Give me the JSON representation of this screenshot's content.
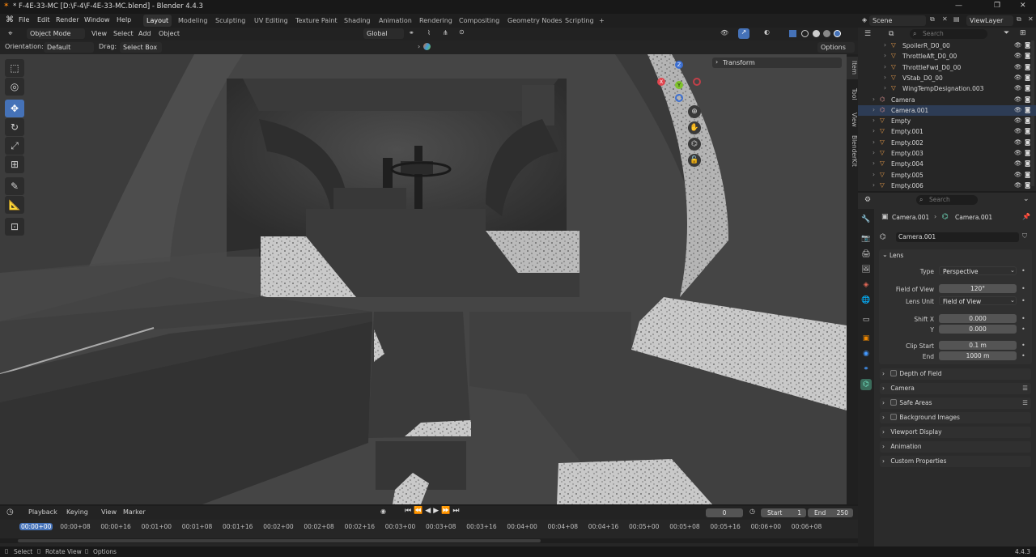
{
  "window": {
    "title": "* F-4E-33-MC [D:\\F-4\\F-4E-33-MC.blend] - Blender 4.4.3",
    "minimize": "—",
    "maximize": "❐",
    "close": "✕"
  },
  "menu": {
    "items": [
      "File",
      "Edit",
      "Render",
      "Window",
      "Help"
    ]
  },
  "workspaces": [
    "Layout",
    "Modeling",
    "Sculpting",
    "UV Editing",
    "Texture Paint",
    "Shading",
    "Animation",
    "Rendering",
    "Compositing",
    "Geometry Nodes",
    "Scripting",
    "+"
  ],
  "scene": {
    "name": "Scene",
    "view_layer": "ViewLayer"
  },
  "viewport_header": {
    "mode": "Object Mode",
    "menus": [
      "View",
      "Select",
      "Add",
      "Object"
    ],
    "transform_orientation": "Global",
    "orientation_label": "Orientation:",
    "orientation_value": "Default",
    "drag_label": "Drag:",
    "drag_value": "Select Box",
    "options": "Options"
  },
  "n_panel": {
    "transform": "Transform",
    "tabs": [
      "Item",
      "Tool",
      "View",
      "BlenderKit"
    ]
  },
  "gizmo": {
    "x": "X",
    "y": "Y",
    "z": "Z"
  },
  "outliner": {
    "search_placeholder": "Search",
    "rows": [
      {
        "name": "SpoilerR_D0_00",
        "indent": 2
      },
      {
        "name": "ThrottleAft_D0_00",
        "indent": 2
      },
      {
        "name": "ThrottleFwd_D0_00",
        "indent": 2
      },
      {
        "name": "VStab_D0_00",
        "indent": 2
      },
      {
        "name": "WingTempDesignation.003",
        "indent": 2
      },
      {
        "name": "Camera",
        "indent": 1
      },
      {
        "name": "Camera.001",
        "indent": 1,
        "selected": true
      },
      {
        "name": "Empty",
        "indent": 1
      },
      {
        "name": "Empty.001",
        "indent": 1
      },
      {
        "name": "Empty.002",
        "indent": 1
      },
      {
        "name": "Empty.003",
        "indent": 1
      },
      {
        "name": "Empty.004",
        "indent": 1
      },
      {
        "name": "Empty.005",
        "indent": 1
      },
      {
        "name": "Empty.006",
        "indent": 1
      }
    ]
  },
  "properties": {
    "search_placeholder": "Search",
    "breadcrumb_object": "Camera.001",
    "breadcrumb_data": "Camera.001",
    "datablock": "Camera.001",
    "lens": {
      "header": "Lens",
      "type_label": "Type",
      "type_value": "Perspective",
      "fov_label": "Field of View",
      "fov_value": "120°",
      "lens_unit_label": "Lens Unit",
      "lens_unit_value": "Field of View",
      "shift_x_label": "Shift X",
      "shift_x_value": "0.000",
      "shift_y_label": "Y",
      "shift_y_value": "0.000",
      "clip_start_label": "Clip Start",
      "clip_start_value": "0.1 m",
      "clip_end_label": "End",
      "clip_end_value": "1000 m"
    },
    "sections": [
      "Depth of Field",
      "Camera",
      "Safe Areas",
      "Background Images",
      "Viewport Display",
      "Animation",
      "Custom Properties"
    ]
  },
  "timeline": {
    "menus": [
      "Playback",
      "Keying",
      "View",
      "Marker"
    ],
    "current_frame": "0",
    "start_label": "Start",
    "start_value": "1",
    "end_label": "End",
    "end_value": "250",
    "ticks": [
      "00:00+00",
      "00:00+08",
      "00:00+16",
      "00:01+00",
      "00:01+08",
      "00:01+16",
      "00:02+00",
      "00:02+08",
      "00:02+16",
      "00:03+00",
      "00:03+08",
      "00:03+16",
      "00:04+00",
      "00:04+08",
      "00:04+16",
      "00:05+00",
      "00:05+08",
      "00:05+16",
      "00:06+00",
      "00:06+08"
    ]
  },
  "status": {
    "select": "Select",
    "rotate": "Rotate View",
    "options": "Options",
    "version": "4.4.3"
  }
}
